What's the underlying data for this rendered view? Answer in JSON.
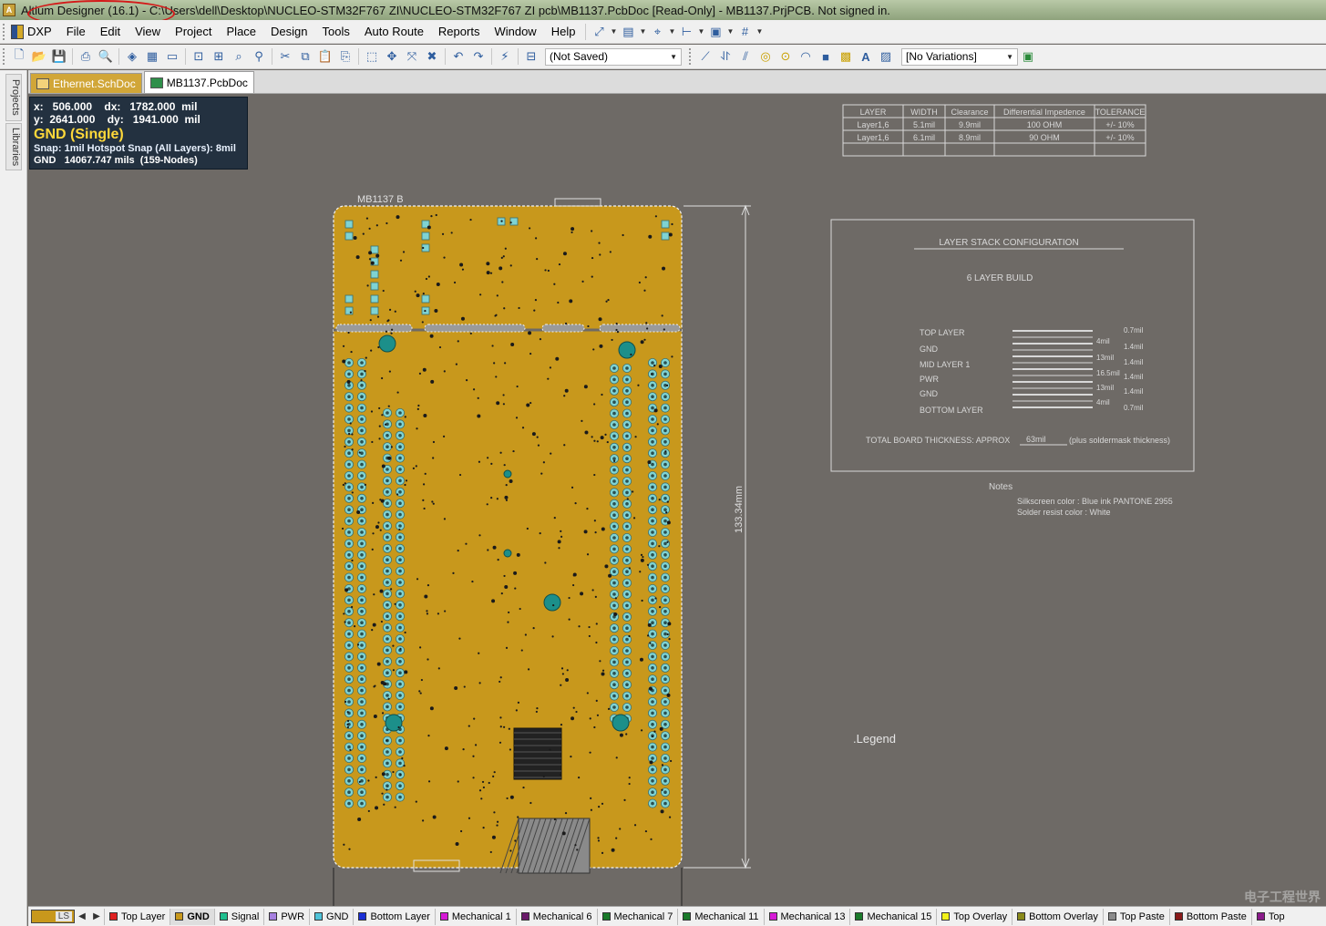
{
  "titlebar": {
    "title": "Altium Designer (16.1) - C:\\Users\\dell\\Desktop\\NUCLEO-STM32F767 ZI\\NUCLEO-STM32F767 ZI pcb\\MB1137.PcbDoc [Read-Only] - MB1137.PrjPCB. Not signed in."
  },
  "menu": {
    "items": [
      "DXP",
      "File",
      "Edit",
      "View",
      "Project",
      "Place",
      "Design",
      "Tools",
      "Auto Route",
      "Reports",
      "Window",
      "Help"
    ]
  },
  "toolbar": {
    "saved_state": "(Not Saved)",
    "variations": "[No Variations]"
  },
  "left_panel": {
    "tabs": [
      "Projects",
      "Libraries"
    ]
  },
  "doc_tabs": [
    {
      "label": "Ethernet.SchDoc",
      "active": false
    },
    {
      "label": "MB1137.PcbDoc",
      "active": true
    }
  ],
  "hud": {
    "line1": "x:   506.000    dx:   1782.000  mil",
    "line2": "y:  2641.000    dy:   1941.000  mil",
    "net": "GND (Single)",
    "snap": "Snap: 1mil Hotspot Snap (All Layers): 8mil",
    "length": "GND   14067.747 mils  (159-Nodes)"
  },
  "impedance_table": {
    "headers": [
      "LAYER",
      "WIDTH",
      "Clearance",
      "Differential Impedence",
      "TOLERANCE"
    ],
    "rows": [
      [
        "Layer1,6",
        "5.1mil",
        "9.9mil",
        "100  OHM",
        "+/-  10%"
      ],
      [
        "Layer1,6",
        "6.1mil",
        "8.9mil",
        "90  OHM",
        "+/-  10%"
      ]
    ]
  },
  "stack": {
    "title": "LAYER STACK CONFIGURATION",
    "build": "6 LAYER BUILD",
    "layers": [
      "TOP  LAYER",
      "GND",
      "MID  LAYER  1",
      "PWR",
      "GND",
      "BOTTOM  LAYER"
    ],
    "right_values": [
      "0.7mil",
      "1.4mil",
      "1.4mil",
      "1.4mil",
      "1.4mil",
      "0.7mil"
    ],
    "mid_values": [
      "4mil",
      "13mil",
      "16.5mil",
      "13mil",
      "4mil"
    ],
    "thickness_prefix": "TOTAL  BOARD  THICKNESS:  APPROX",
    "thickness_value": "63mil",
    "thickness_suffix": "(plus  soldermask  thickness)"
  },
  "notes": {
    "heading": "Notes",
    "lines": [
      "Silkscreen  color :  Blue ink PANTONE  2955",
      "Solder  resist  color :  White"
    ]
  },
  "board": {
    "label": "MB1137  B",
    "dimension": "133.34mm",
    "legend": ".Legend",
    "fill_color": "#c8981c",
    "outline_color": "#f2f2f2",
    "pad_color": "#7fd3d3",
    "via_color": "#1c8f8a"
  },
  "layer_tabs": {
    "current": "LS",
    "items": [
      {
        "label": "Top Layer",
        "color": "#e02020"
      },
      {
        "label": "GND",
        "color": "#c8981c",
        "active": true
      },
      {
        "label": "Signal",
        "color": "#1fbf8f"
      },
      {
        "label": "PWR",
        "color": "#a680e0"
      },
      {
        "label": "GND",
        "color": "#4fc3d9"
      },
      {
        "label": "Bottom Layer",
        "color": "#1a2fd6"
      },
      {
        "label": "Mechanical 1",
        "color": "#d61ad6"
      },
      {
        "label": "Mechanical 6",
        "color": "#6a1a6a"
      },
      {
        "label": "Mechanical 7",
        "color": "#1a7a2a"
      },
      {
        "label": "Mechanical 11",
        "color": "#1a7a2a"
      },
      {
        "label": "Mechanical 13",
        "color": "#d61ad6"
      },
      {
        "label": "Mechanical 15",
        "color": "#1a7a2a"
      },
      {
        "label": "Top Overlay",
        "color": "#f2f21a"
      },
      {
        "label": "Bottom Overlay",
        "color": "#8a8a1a"
      },
      {
        "label": "Top Paste",
        "color": "#8a8a8a"
      },
      {
        "label": "Bottom Paste",
        "color": "#8a1a1a"
      },
      {
        "label": "Top",
        "color": "#8a1a8a"
      }
    ]
  }
}
